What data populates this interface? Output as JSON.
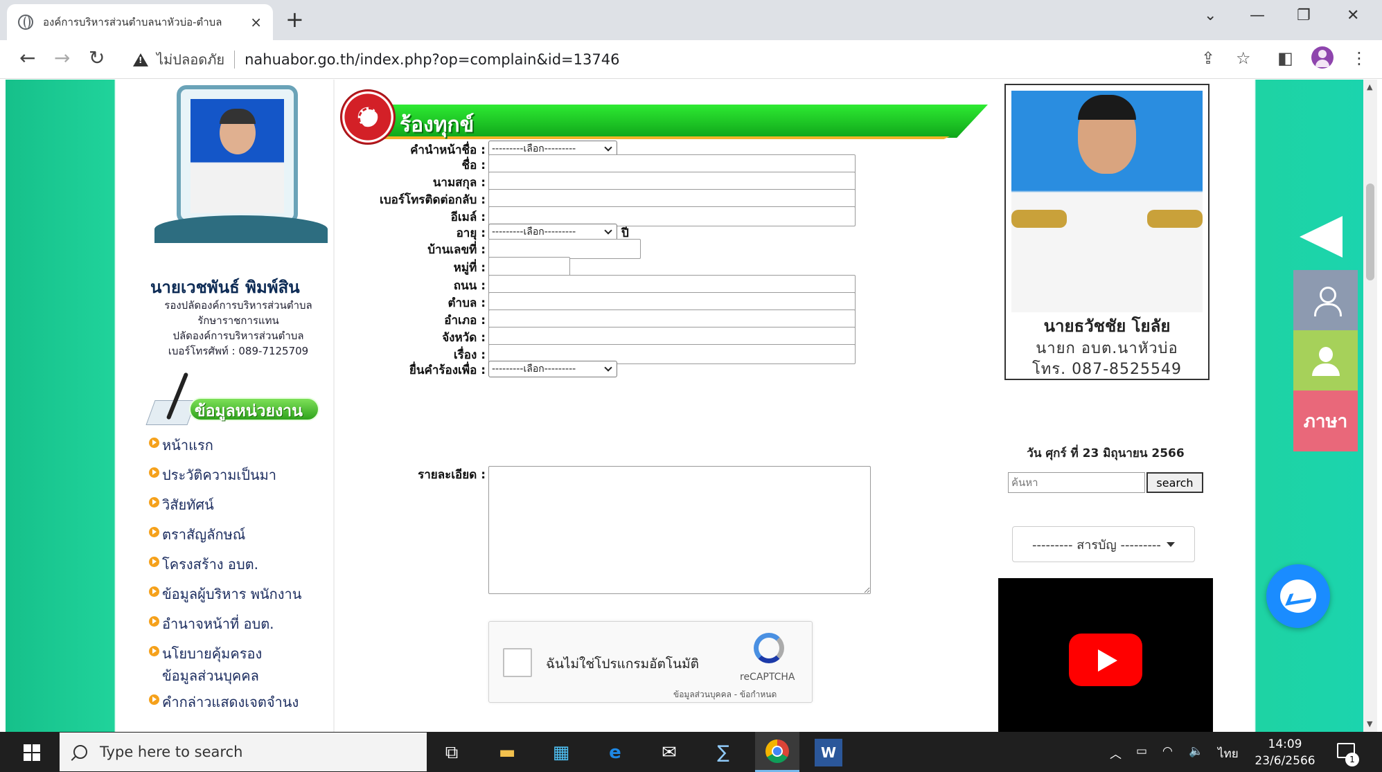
{
  "browser": {
    "tab_title": "องค์การบริหารส่วนตำบลนาหัวบ่อ-ตำบล",
    "tab_close": "×",
    "new_tab": "+",
    "address_security": "ไม่ปลอดภัย",
    "url": "nahuabor.go.th/index.php?op=complain&id=13746"
  },
  "left": {
    "person_name": "นายเวชพันธ์  พิมพ์สิน",
    "person_lines": [
      "รองปลัดองค์การบริหารส่วนตำบล",
      "รักษาราชการแทน",
      "ปลัดองค์การบริหารส่วนตำบล",
      "เบอร์โทรศัพท์ : 089-7125709"
    ],
    "unit_banner": "ข้อมูลหน่วยงาน",
    "menu": [
      "หน้าแรก",
      "ประวัติความเป็นมา",
      "วิสัยทัศน์",
      "ตราสัญลักษณ์",
      "โครงสร้าง อบต.",
      "ข้อมูลผู้บริหาร พนักงาน",
      "อำนาจหน้าที่ อบต.",
      "นโยบายคุ้มครอง",
      "ข้อมูลส่วนบุคคล",
      "คำกล่าวแสดงเจตจำนง"
    ]
  },
  "form": {
    "banner_title": "ร้องทุกข์",
    "labels": {
      "prefix": "คำนำหน้าชื่อ :",
      "first_name": "ชื่อ :",
      "last_name": "นามสกุล :",
      "phone": "เบอร์โทรติดต่อกลับ :",
      "email": "อีเมล์ :",
      "age": "อายุ :",
      "house_no": "บ้านเลขที่ :",
      "moo": "หมู่ที่ :",
      "road": "ถนน :",
      "tambon": "ตำบล :",
      "amphoe": "อำเภอ :",
      "province": "จังหวัด :",
      "subject": "เรื่อง :",
      "purpose": "ยื่นคำร้องเพื่อ :",
      "details": "รายละเอียด :"
    },
    "select_default": "---------เลือก---------",
    "age_unit": "ปี",
    "captcha": {
      "text": "ฉันไม่ใช่โปรแกรมอัตโนมัติ",
      "brand": "reCAPTCHA",
      "terms": "ข้อมูลส่วนบุคคล - ข้อกำหนด"
    }
  },
  "right": {
    "mayor_name": "นายธวัชชัย  โยลัย",
    "mayor_title": "นายก  อบต.นาหัวบ่อ",
    "mayor_phone": "โทร.  087-8525549",
    "date": "วัน ศุกร์ ที่ 23 มิถุนายน 2566",
    "search_placeholder": "ค้นหา",
    "search_button": "search",
    "toc": "--------- สารบัญ ---------"
  },
  "widgets": {
    "language": "ภาษา"
  },
  "taskbar": {
    "search_placeholder": "Type here to search",
    "lang": "ไทย",
    "time": "14:09",
    "date": "23/6/2566",
    "notifications": "1"
  },
  "colors": {
    "page_gradient": "#1fd39c",
    "banner_green": "#12b21c",
    "seal_red": "#d32027",
    "menu_bullet": "#f5a11b",
    "youtube_red": "#ff0000",
    "messenger_blue": "#1a8cff"
  }
}
